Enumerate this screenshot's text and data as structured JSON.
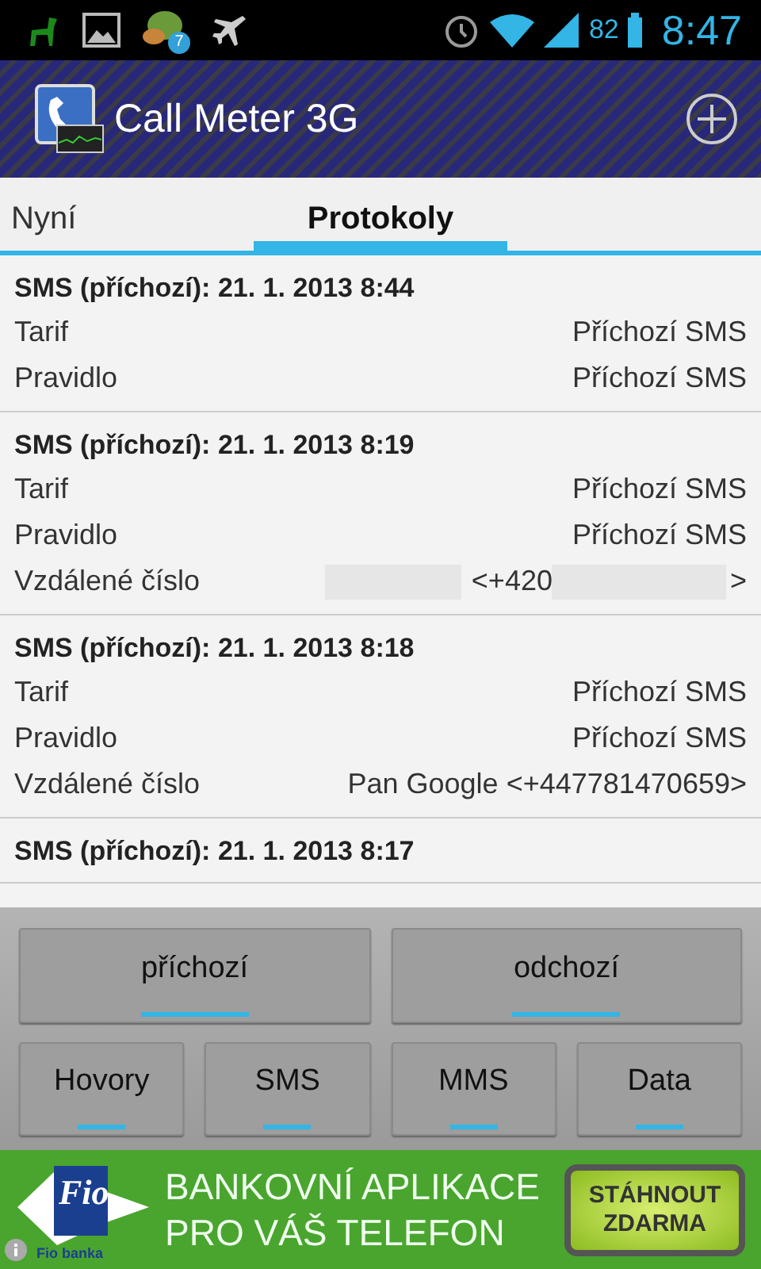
{
  "status_bar": {
    "notification_badge": "7",
    "battery": "82",
    "time": "8:47"
  },
  "action_bar": {
    "title": "Call Meter 3G"
  },
  "tabs": [
    {
      "label": "Nyní",
      "selected": false
    },
    {
      "label": "Protokoly",
      "selected": true
    }
  ],
  "log": [
    {
      "title": "SMS (příchozí): 21. 1. 2013 8:44",
      "rows": [
        {
          "label": "Tarif",
          "value": "Příchozí SMS"
        },
        {
          "label": "Pravidlo",
          "value": "Příchozí SMS"
        }
      ]
    },
    {
      "title": "SMS (příchozí): 21. 1. 2013 8:19",
      "rows": [
        {
          "label": "Tarif",
          "value": "Příchozí SMS"
        },
        {
          "label": "Pravidlo",
          "value": "Příchozí SMS"
        },
        {
          "label": "Vzdálené číslo",
          "value": "<+420",
          "suffix": ">",
          "redacted": true
        }
      ]
    },
    {
      "title": "SMS (příchozí): 21. 1. 2013 8:18",
      "rows": [
        {
          "label": "Tarif",
          "value": "Příchozí SMS"
        },
        {
          "label": "Pravidlo",
          "value": "Příchozí SMS"
        },
        {
          "label": "Vzdálené číslo",
          "value": "Pan Google <+447781470659>",
          "redacted": false
        }
      ]
    },
    {
      "title": "SMS (příchozí): 21. 1. 2013 8:17"
    }
  ],
  "direction_filters": [
    {
      "label": "příchozí",
      "on": true
    },
    {
      "label": "odchozí",
      "on": true
    }
  ],
  "type_filters": [
    {
      "label": "Hovory",
      "on": true
    },
    {
      "label": "SMS",
      "on": true
    },
    {
      "label": "MMS",
      "on": true
    },
    {
      "label": "Data",
      "on": true
    }
  ],
  "ad": {
    "logo": "Fio",
    "logo_caption": "Fio banka",
    "headline": [
      "BANKOVNÍ APLIKACE",
      "PRO VÁŠ TELEFON"
    ],
    "button": [
      "STÁHNOUT",
      "ZDARMA"
    ]
  }
}
